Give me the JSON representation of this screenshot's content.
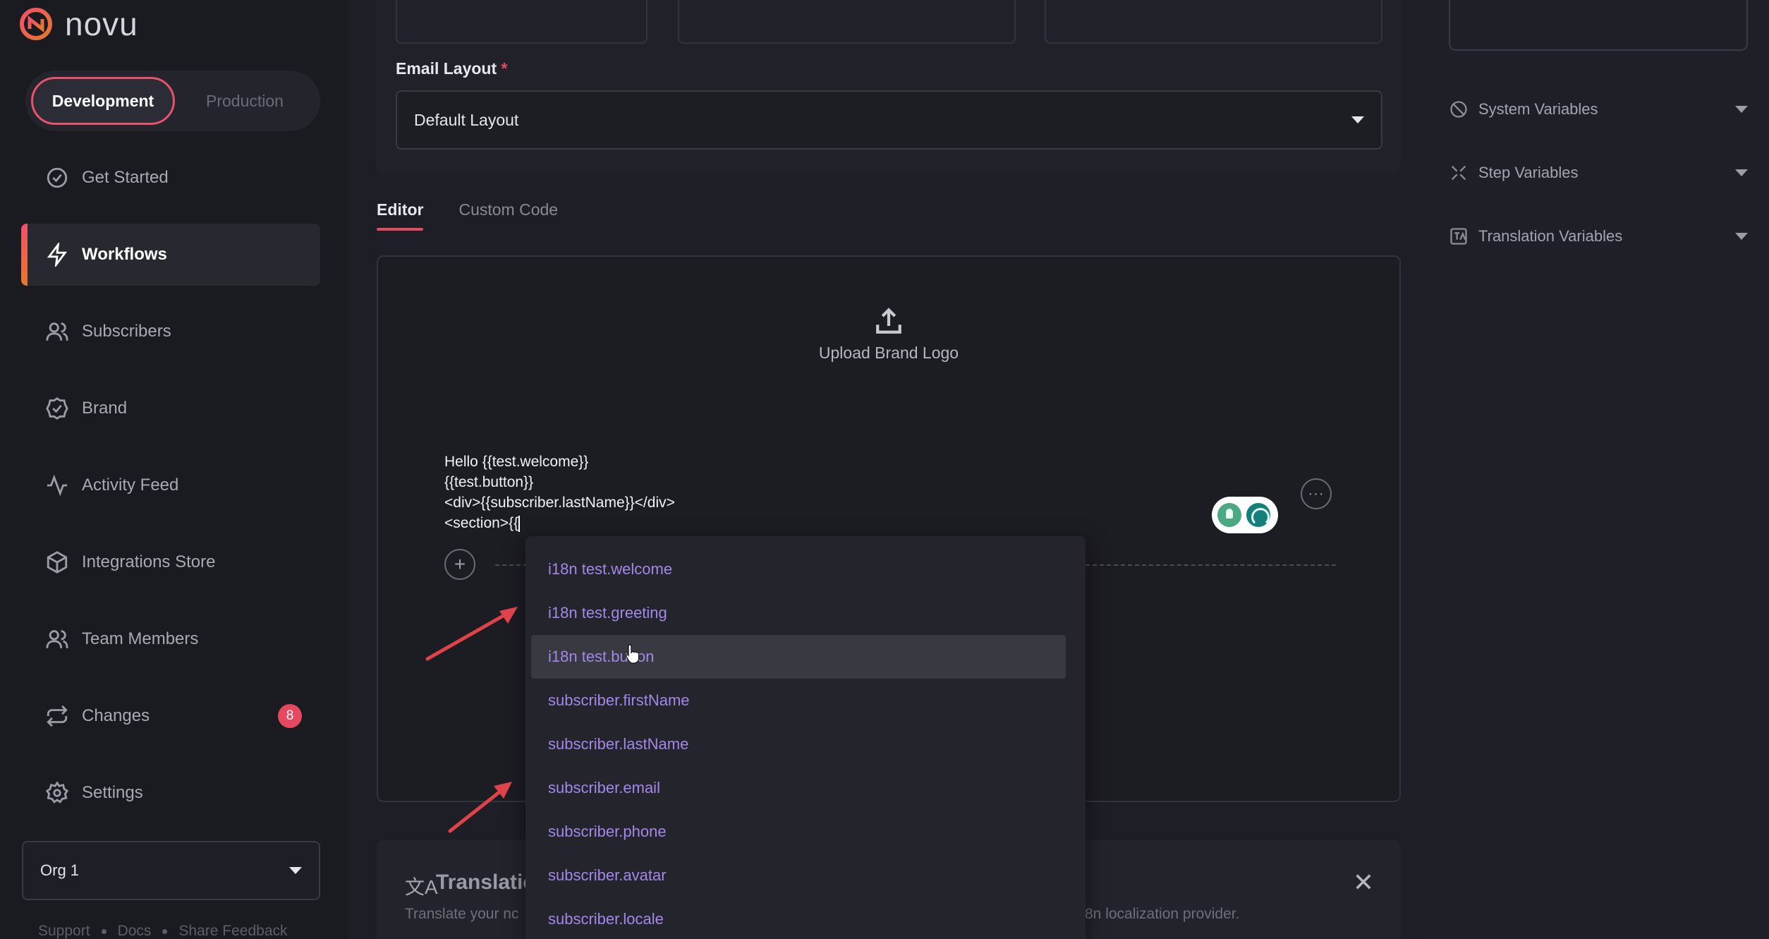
{
  "app": {
    "brand": "novu"
  },
  "env": {
    "development": "Development",
    "production": "Production"
  },
  "nav": {
    "items": [
      {
        "label": "Get Started"
      },
      {
        "label": "Workflows"
      },
      {
        "label": "Subscribers"
      },
      {
        "label": "Brand"
      },
      {
        "label": "Activity Feed"
      },
      {
        "label": "Integrations Store"
      },
      {
        "label": "Team Members"
      },
      {
        "label": "Changes",
        "badge": "8"
      },
      {
        "label": "Settings"
      }
    ]
  },
  "org": {
    "selected": "Org 1"
  },
  "footer": {
    "support": "Support",
    "docs": "Docs",
    "feedback": "Share Feedback"
  },
  "form": {
    "email_layout_label": "Email Layout",
    "required_mark": "*",
    "email_layout_value": "Default Layout"
  },
  "tabs": {
    "editor": "Editor",
    "custom_code": "Custom Code"
  },
  "editor": {
    "upload_label": "Upload Brand Logo",
    "lines": [
      "Hello {{test.welcome}}",
      "{{test.button}}",
      "<div>{{subscriber.lastName}}</div>",
      "<section>{{"
    ],
    "more": "···",
    "plus": "+"
  },
  "autocomplete": {
    "items": [
      "i18n test.welcome",
      "i18n test.greeting",
      "i18n test.button",
      "subscriber.firstName",
      "subscriber.lastName",
      "subscriber.email",
      "subscriber.phone",
      "subscriber.avatar",
      "subscriber.locale"
    ],
    "selected_index": 2
  },
  "translation": {
    "title": "Translatic",
    "desc_left": "Translate your nc",
    "desc_right": "8n localization provider.",
    "close": "✕"
  },
  "right_panel": {
    "system_variables": "System Variables",
    "step_variables": "Step Variables",
    "translation_variables": "Translation Variables"
  },
  "colors": {
    "accent": "#e5485f",
    "link": "#a487e8",
    "arrow": "#e0424a"
  }
}
